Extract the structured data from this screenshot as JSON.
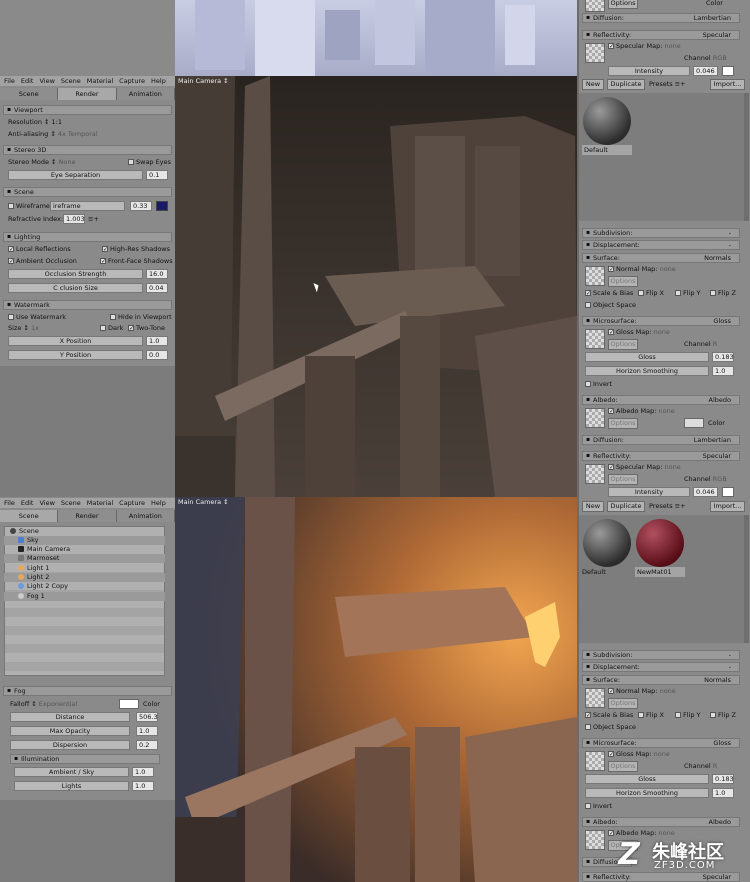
{
  "top_fragment": {
    "options_label": "Options",
    "color_label": "Color",
    "diffusion": {
      "label": "Diffusion:",
      "value": "Lambertian"
    },
    "reflectivity": {
      "label": "Reflectivity:",
      "value": "Specular"
    },
    "specular_map": "Specular Map:",
    "none": "none",
    "channel": "Channel",
    "rgb": "RGB",
    "intensity_label": "Intensity",
    "intensity_value": "0.046"
  },
  "panel1": {
    "menu": [
      "File",
      "Edit",
      "View",
      "Scene",
      "Material",
      "Capture",
      "Help"
    ],
    "tabs": [
      "Scene",
      "Render",
      "Animation"
    ],
    "viewport_title": "Main Camera ↕",
    "viewport": {
      "header": "Viewport",
      "resolution": "Resolution ↕ 1:1",
      "antialias_label": "Anti-aliasing ↕",
      "antialias_value": "4x Temporal"
    },
    "stereo": {
      "header": "Stereo 3D",
      "mode_label": "Stereo Mode ↕",
      "mode_value": "None",
      "swap_eyes": "Swap Eyes",
      "eye_sep": "Eye Separation",
      "eye_sep_value": "0.1"
    },
    "scene": {
      "header": "Scene",
      "wireframe": "Wireframe",
      "wireframe_field": "ireframe",
      "wire_value": "0.33",
      "refr_label": "Refractive Index:",
      "refr_value": "1.003",
      "refr_extra": "≡+"
    },
    "lighting": {
      "header": "Lighting",
      "local_refl": "Local Reflections",
      "hires_shadows": "High-Res Shadows",
      "ao": "Ambient Occlusion",
      "front_shadows": "Front-Face Shadows",
      "occ_strength": "Occlusion Strength",
      "occ_strength_value": "16.0",
      "occ_size": "C  clusion Size",
      "occ_size_value": "0.04"
    },
    "watermark": {
      "header": "Watermark",
      "use": "Use Watermark",
      "hide": "Hide in Viewport",
      "size_label": "Size ↕",
      "size_value": "1x",
      "dark": "Dark",
      "twotone": "Two-Tone",
      "xpos": "X Position",
      "xpos_value": "1.0",
      "ypos": "Y Position",
      "ypos_value": "0.0"
    },
    "right": {
      "buttons": {
        "new": "New",
        "duplicate": "Duplicate",
        "presets": "Presets ≡+",
        "import": "Import..."
      },
      "materials": [
        "Default"
      ],
      "subdivision": "Subdivision:",
      "displacement": "Displacement:",
      "dash": "-",
      "surface": {
        "label": "Surface:",
        "value": "Normals"
      },
      "normal_map": "Normal Map:",
      "none": "none",
      "options": "Options",
      "scale_bias": "Scale & Bias",
      "flipx": "Flip X",
      "flipy": "Flip Y",
      "flipz": "Flip Z",
      "object_space": "Object Space",
      "microsurface": {
        "label": "Microsurface:",
        "value": "Gloss"
      },
      "gloss_map": "Gloss Map:",
      "channel": "Channel",
      "r": "R",
      "gloss": "Gloss",
      "gloss_value": "0.183",
      "horizon": "Horizon Smoothing",
      "horizon_value": "1.0",
      "invert": "Invert",
      "albedo": {
        "label": "Albedo:",
        "value": "Albedo"
      },
      "albedo_map": "Albedo Map:",
      "color": "Color",
      "diffusion": {
        "label": "Diffusion:",
        "value": "Lambertian"
      },
      "reflectivity": {
        "label": "Reflectivity:",
        "value": "Specular"
      },
      "specular_map": "Specular Map:",
      "rgb": "RGB",
      "intensity": "Intensity",
      "intensity_value": "0.046"
    }
  },
  "panel2": {
    "menu": [
      "File",
      "Edit",
      "View",
      "Scene",
      "Material",
      "Capture",
      "Help"
    ],
    "tabs": [
      "Scene",
      "Render",
      "Animation"
    ],
    "viewport_title": "Main Camera ↕",
    "tree": [
      "Scene",
      "Sky",
      "Main Camera",
      "Marmoset",
      "Light 1",
      "Light 2",
      "Light 2 Copy",
      "Fog 1"
    ],
    "fog": {
      "header": "Fog",
      "falloff_label": "Falloff ↕",
      "falloff_value": "Exponential",
      "color": "Color",
      "distance": "Distance",
      "distance_value": "506.3",
      "max_opacity": "Max Opacity",
      "max_opacity_value": "1.0",
      "dispersion": "Dispersion",
      "dispersion_value": "0.2"
    },
    "illumination": {
      "header": "Illumination",
      "ambient": "Ambient / Sky",
      "ambient_value": "1.0",
      "lights": "Lights",
      "lights_value": "1.0"
    },
    "right": {
      "buttons": {
        "new": "New",
        "duplicate": "Duplicate",
        "presets": "Presets ≡+",
        "import": "Import..."
      },
      "materials": [
        "Default",
        "NewMat01"
      ],
      "subdivision": "Subdivision:",
      "displacement": "Displacement:",
      "dash": "-",
      "surface": {
        "label": "Surface:",
        "value": "Normals"
      },
      "normal_map": "Normal Map:",
      "none": "none",
      "options": "Options",
      "scale_bias": "Scale & Bias",
      "flipx": "Flip X",
      "flipy": "Flip Y",
      "flipz": "Flip Z",
      "object_space": "Object Space",
      "microsurface": {
        "label": "Microsurface:",
        "value": "Gloss"
      },
      "gloss_map": "Gloss Map:",
      "channel": "Channel",
      "r": "R",
      "gloss": "Gloss",
      "gloss_value": "0.183",
      "horizon": "Horizon Smoothing",
      "horizon_value": "1.0",
      "invert": "Invert",
      "albedo": {
        "label": "Albedo:",
        "value": "Albedo"
      },
      "albedo_map": "Albedo Map:",
      "diffusion": "Diffusion",
      "reflectivity": {
        "label": "Reflectivity:",
        "value": "Specular"
      }
    }
  },
  "watermark_logo": {
    "brand": "朱峰社区",
    "url": "ZF3D.COM"
  }
}
